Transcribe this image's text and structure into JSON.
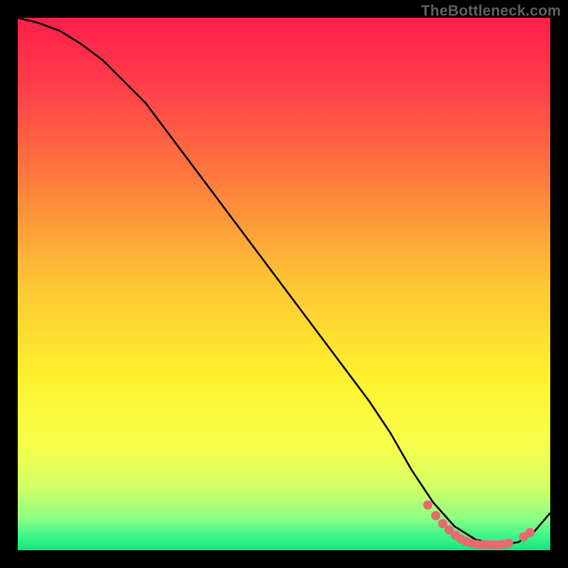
{
  "watermark": "TheBottleneck.com",
  "gradient_stops": [
    {
      "offset": 0.0,
      "color": "#ff1f4b"
    },
    {
      "offset": 0.12,
      "color": "#ff3b4a"
    },
    {
      "offset": 0.3,
      "color": "#ff7a3e"
    },
    {
      "offset": 0.5,
      "color": "#fec634"
    },
    {
      "offset": 0.68,
      "color": "#fef22e"
    },
    {
      "offset": 0.8,
      "color": "#f7ff4a"
    },
    {
      "offset": 0.88,
      "color": "#d4ff66"
    },
    {
      "offset": 0.94,
      "color": "#8dff82"
    },
    {
      "offset": 0.975,
      "color": "#39f58a"
    },
    {
      "offset": 1.0,
      "color": "#18e57a"
    }
  ],
  "chart_data": {
    "type": "line",
    "title": "",
    "xlabel": "",
    "ylabel": "",
    "xlim": [
      0,
      100
    ],
    "ylim": [
      0,
      100
    ],
    "series": [
      {
        "name": "curve",
        "x": [
          0,
          4,
          8,
          12,
          16,
          20,
          24,
          30,
          36,
          42,
          48,
          54,
          60,
          66,
          70,
          74,
          78,
          82,
          86,
          90,
          94,
          97,
          100
        ],
        "y": [
          100,
          99,
          97.5,
          95,
          92,
          88,
          84,
          76,
          68,
          60,
          52,
          44,
          36,
          28,
          22,
          15,
          9,
          4.5,
          2,
          1,
          1.5,
          3.5,
          7
        ]
      }
    ],
    "markers": [
      {
        "x": 77.0,
        "y": 8.5
      },
      {
        "x": 78.5,
        "y": 6.5
      },
      {
        "x": 79.8,
        "y": 5.0
      },
      {
        "x": 81.0,
        "y": 3.8
      },
      {
        "x": 82.2,
        "y": 2.8
      },
      {
        "x": 83.2,
        "y": 2.1
      },
      {
        "x": 84.2,
        "y": 1.6
      },
      {
        "x": 85.2,
        "y": 1.3
      },
      {
        "x": 86.2,
        "y": 1.1
      },
      {
        "x": 87.2,
        "y": 1.0
      },
      {
        "x": 88.2,
        "y": 1.0
      },
      {
        "x": 89.2,
        "y": 1.0
      },
      {
        "x": 90.2,
        "y": 1.0
      },
      {
        "x": 91.2,
        "y": 1.1
      },
      {
        "x": 92.2,
        "y": 1.3
      },
      {
        "x": 95.0,
        "y": 2.5
      },
      {
        "x": 96.2,
        "y": 3.3
      }
    ]
  }
}
